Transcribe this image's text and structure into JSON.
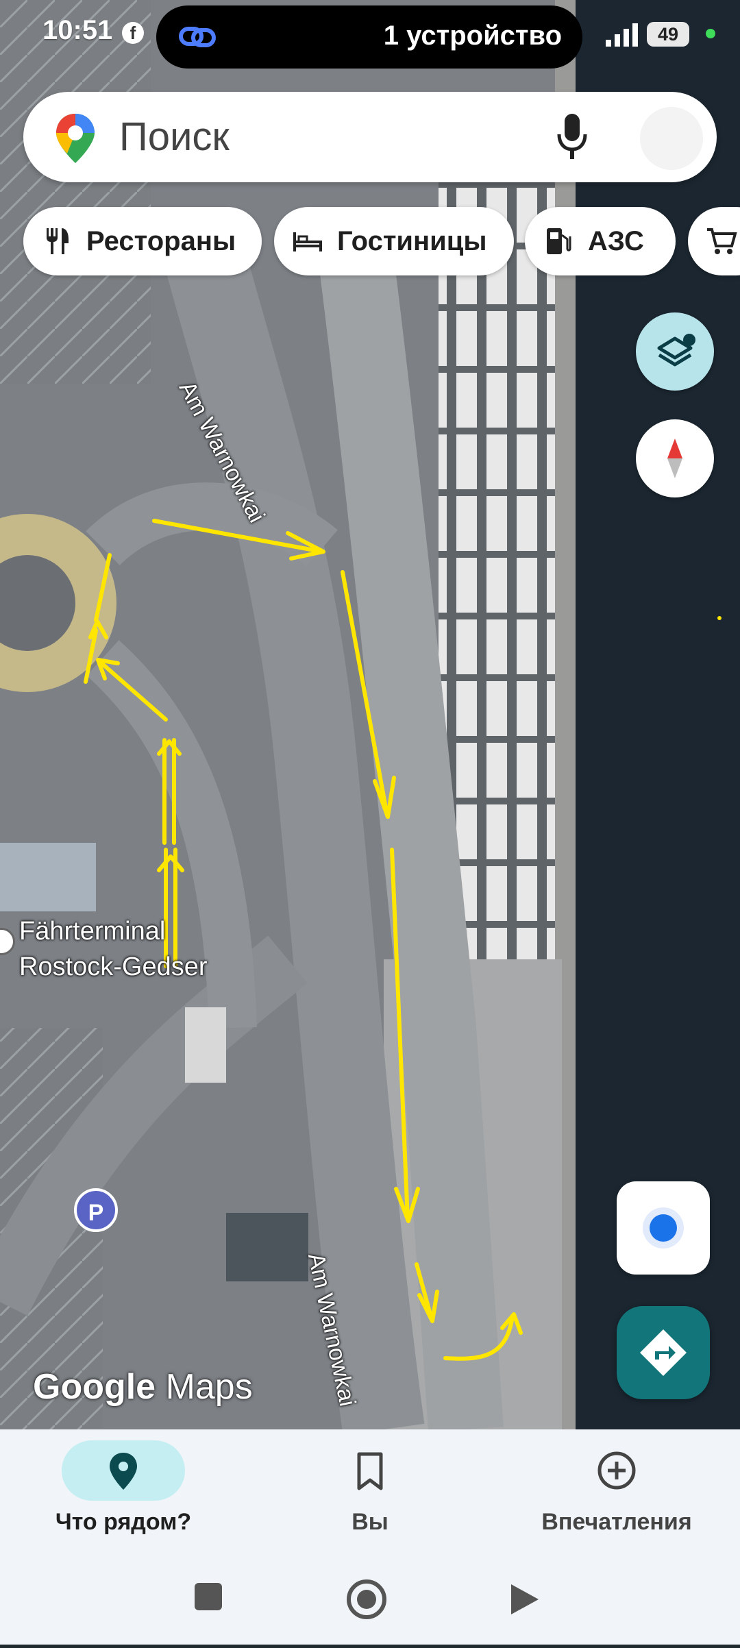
{
  "status_bar": {
    "time": "10:51",
    "device_pill_text": "1 устройство",
    "battery": "49"
  },
  "search": {
    "placeholder": "Поиск",
    "icons": [
      "google-maps-pin-icon",
      "mic-icon",
      "avatar"
    ]
  },
  "chips": [
    {
      "label": "Рестораны",
      "icon": "fork-knife-icon"
    },
    {
      "label": "Гостиницы",
      "icon": "bed-icon"
    },
    {
      "label": "АЗС",
      "icon": "gas-pump-icon"
    },
    {
      "label": "",
      "icon": "cart-icon"
    }
  ],
  "map": {
    "labels": {
      "terminal_line1": "Fährterminal",
      "terminal_line2": "Rostock-Gedser",
      "road_top": "Am Warnowkai",
      "road_bottom": "Am Warnowkai",
      "parking": "P"
    },
    "watermark_google": "Google",
    "watermark_maps": "Maps",
    "annotation_color": "#ffe600"
  },
  "bottom_nav": {
    "tabs": [
      {
        "label": "Что рядом?",
        "icon": "pin-icon",
        "active": true
      },
      {
        "label": "Вы",
        "icon": "bookmark-icon",
        "active": false
      },
      {
        "label": "Впечатления",
        "icon": "plus-circle-icon",
        "active": false
      }
    ]
  }
}
